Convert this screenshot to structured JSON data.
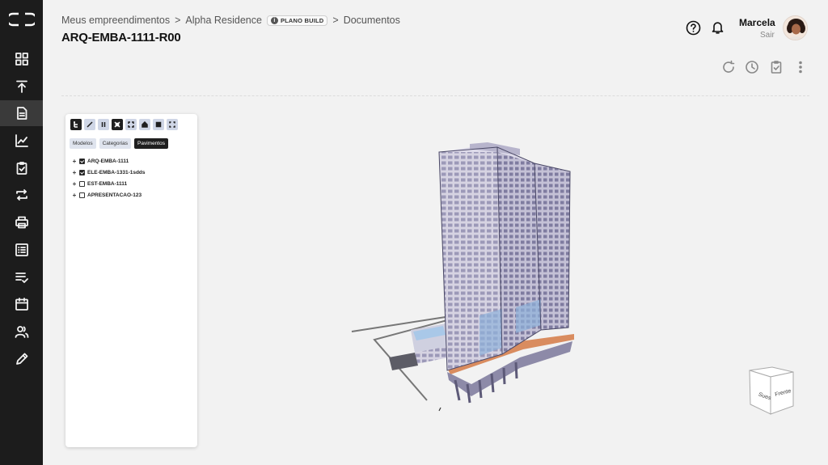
{
  "sidebar": {
    "items": [
      {
        "icon": "dashboard-icon"
      },
      {
        "icon": "upload-icon"
      },
      {
        "icon": "document-icon",
        "active": true
      },
      {
        "icon": "chart-icon"
      },
      {
        "icon": "clipboard-check-icon"
      },
      {
        "icon": "repeat-icon"
      },
      {
        "icon": "printer-icon"
      },
      {
        "icon": "list-icon"
      },
      {
        "icon": "checklist-icon"
      },
      {
        "icon": "calendar-icon"
      },
      {
        "icon": "users-icon"
      },
      {
        "icon": "pencil-icon"
      }
    ]
  },
  "breadcrumb": {
    "item1": "Meus empreendimentos",
    "sep1": ">",
    "item2": "Alpha Residence",
    "badge": "PLANO BUILD",
    "sep2": ">",
    "item3": "Documentos"
  },
  "page": {
    "title": "ARQ-EMBA-1111-R00"
  },
  "user": {
    "name": "Marcela",
    "logout": "Sair"
  },
  "toolbar": {
    "icons": [
      "refresh-icon",
      "history-icon",
      "clipboard-check-icon",
      "more-vertical-icon"
    ]
  },
  "panel": {
    "tabs": [
      {
        "label": "Modelos"
      },
      {
        "label": "Categorias"
      },
      {
        "label": "Pavimentos",
        "active": true
      }
    ],
    "tree": [
      {
        "label": "ARQ-EMBA-1111",
        "checked": true
      },
      {
        "label": "ELE-EMBA-1331-1sdds",
        "checked": true
      },
      {
        "label": "EST-EMBA-1111",
        "checked": false
      },
      {
        "label": "APRESENTACAO-123",
        "checked": false
      }
    ]
  },
  "navcube": {
    "left": "Sues",
    "front": "Frente"
  },
  "colors": {
    "sidebar": "#1c1c1c",
    "background": "#f2f2f2",
    "accent": "#1f1f1f"
  }
}
